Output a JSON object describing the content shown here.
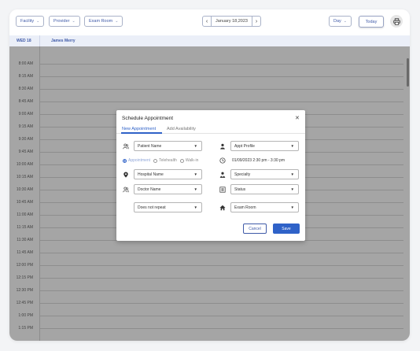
{
  "toolbar": {
    "facility_label": "Facility",
    "provider_label": "Provider",
    "exam_room_label": "Exam Room",
    "date_label": "January 18,2023",
    "view_label": "Day",
    "today_label": "Today",
    "prev_icon": "chevron-left-icon",
    "next_icon": "chevron-right-icon",
    "print_icon": "printer-icon"
  },
  "calendar": {
    "day_label": "WED 18",
    "provider_name": "James Merry",
    "times": [
      "8:00 AM",
      "8:15 AM",
      "8:30 AM",
      "8:45 AM",
      "9:00 AM",
      "9:15 AM",
      "9:30 AM",
      "9:45 AM",
      "10:00 AM",
      "10:15 AM",
      "10:30 AM",
      "10:45 AM",
      "11:00 AM",
      "11:15 AM",
      "11:30 AM",
      "11:45 AM",
      "12:00 PM",
      "12:15 PM",
      "12:30 PM",
      "12:45 PM",
      "1:00 PM",
      "1:15 PM"
    ]
  },
  "modal": {
    "title": "Schedule Appointment",
    "close_icon": "close-icon",
    "tabs": [
      {
        "label": "New Appointment",
        "active": true
      },
      {
        "label": "Add Availability",
        "active": false
      }
    ],
    "fields": {
      "patient": "Patient Name",
      "appt_profile": "Appt Profile",
      "hospital": "Hospital Name",
      "specialty": "Specialty",
      "doctor": "Doctor Name",
      "status": "Status",
      "repeat": "Does not repeat",
      "exam_room": "Exam Room"
    },
    "visit_types": [
      {
        "label": "Appointment",
        "selected": true
      },
      {
        "label": "Telehealth",
        "selected": false
      },
      {
        "label": "Walk-in",
        "selected": false
      }
    ],
    "datetime": "01/09/2023  2:30 pm - 3:30 pm",
    "cancel_label": "Cancel",
    "save_label": "Save"
  },
  "colors": {
    "accent": "#2f62c8",
    "toolbar_text": "#3f5aa8",
    "overlay": "#282828"
  }
}
